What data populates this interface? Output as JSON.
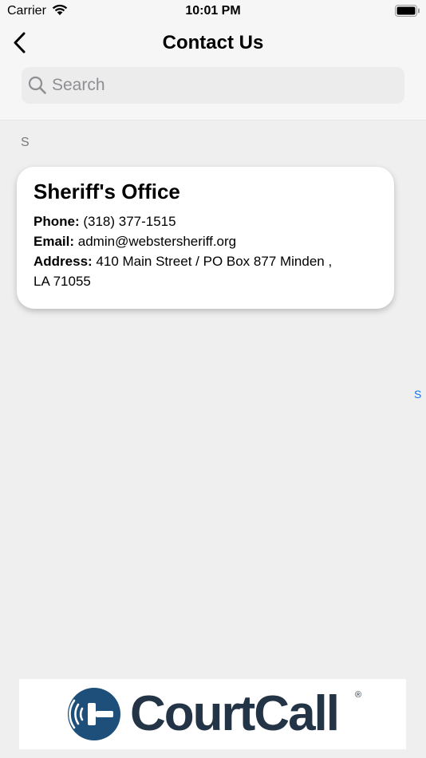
{
  "status_bar": {
    "carrier": "Carrier",
    "time": "10:01 PM"
  },
  "nav": {
    "title": "Contact Us",
    "back_icon": "chevron-left-icon"
  },
  "search": {
    "placeholder": "Search",
    "value": ""
  },
  "section": {
    "header": "S"
  },
  "contacts": [
    {
      "name": "Sheriff's Office",
      "phone_label": "Phone:",
      "phone": "(318) 377-1515",
      "email_label": "Email:",
      "email": "admin@webstersheriff.org",
      "address_label": "Address:",
      "address_line1": "410 Main Street / PO Box 877 Minden ,",
      "address_line2": "LA 71055"
    }
  ],
  "index": {
    "letters": [
      "S"
    ]
  },
  "banner": {
    "logo_text": "CourtCall",
    "registered_mark": "®"
  },
  "colors": {
    "accent": "#1a73e8",
    "logo": "#243447",
    "background": "#efefef"
  }
}
